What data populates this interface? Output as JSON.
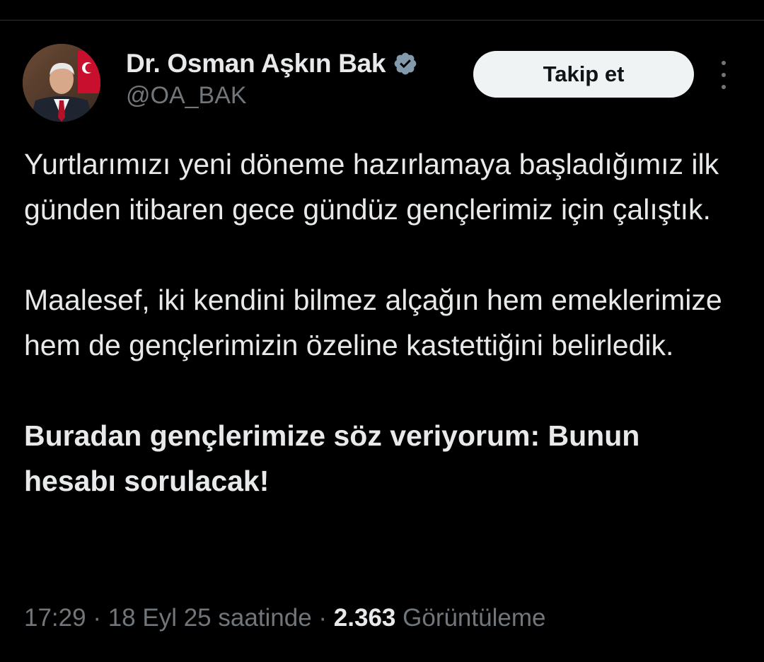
{
  "author": {
    "display_name": "Dr. Osman Aşkın Bak",
    "handle": "@OA_BAK",
    "avatar_icon": "profile-photo",
    "verified_icon": "verified-badge-icon"
  },
  "actions": {
    "follow_label": "Takip et",
    "more_icon": "more-options-icon"
  },
  "tweet": {
    "paragraphs": [
      "Yurtlarımızı yeni döneme hazırlamaya başladığımız ilk günden itibaren gece gündüz gençlerimiz için çalıştık.",
      "Maalesef, iki kendini bilmez alçağın hem emeklerimize hem de gençlerimizin özeline kastettiğini belirledik.",
      "Buradan gençlerimize söz veriyorum: Bunun hesabı sorulacak!"
    ]
  },
  "meta": {
    "time": "17:29",
    "separator": " · ",
    "date": "18 Eyl 25 saatinde",
    "views_count": "2.363",
    "views_label": "Görüntüleme"
  },
  "colors": {
    "background": "#000000",
    "text_primary": "#e7e9ea",
    "text_secondary": "#71767b",
    "verified": "#829aab",
    "follow_bg": "#eff3f4"
  }
}
